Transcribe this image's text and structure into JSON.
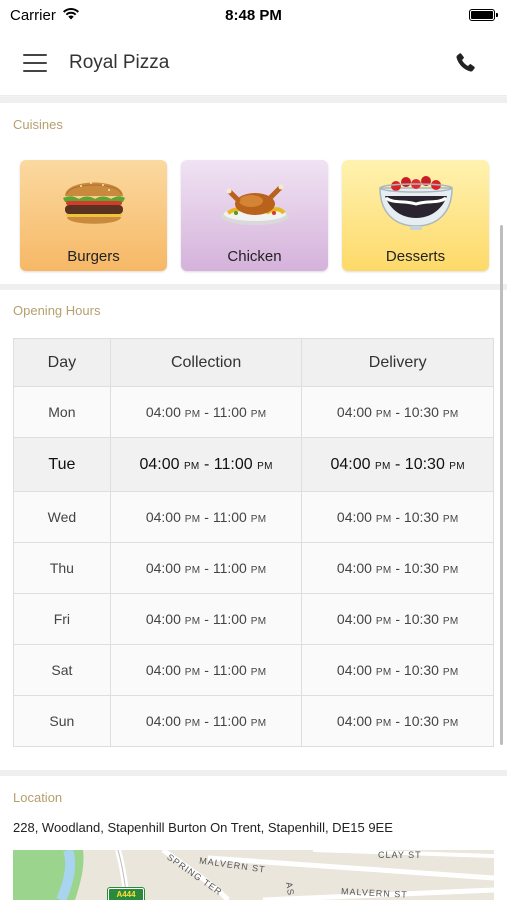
{
  "status_bar": {
    "carrier": "Carrier",
    "time": "8:48 PM"
  },
  "header": {
    "title": "Royal Pizza"
  },
  "cuisines": {
    "label": "Cuisines",
    "items": [
      {
        "name": "Burgers",
        "icon": "burger-icon"
      },
      {
        "name": "Chicken",
        "icon": "roast-chicken-icon"
      },
      {
        "name": "Desserts",
        "icon": "dessert-bowl-icon"
      }
    ]
  },
  "opening_hours": {
    "label": "Opening Hours",
    "columns": [
      "Day",
      "Collection",
      "Delivery"
    ],
    "rows": [
      {
        "day": "Mon",
        "collection": [
          "04:00",
          "PM",
          "11:00",
          "PM"
        ],
        "delivery": [
          "04:00",
          "PM",
          "10:30",
          "PM"
        ]
      },
      {
        "day": "Tue",
        "collection": [
          "04:00",
          "PM",
          "11:00",
          "PM"
        ],
        "delivery": [
          "04:00",
          "PM",
          "10:30",
          "PM"
        ],
        "highlight": true
      },
      {
        "day": "Wed",
        "collection": [
          "04:00",
          "PM",
          "11:00",
          "PM"
        ],
        "delivery": [
          "04:00",
          "PM",
          "10:30",
          "PM"
        ]
      },
      {
        "day": "Thu",
        "collection": [
          "04:00",
          "PM",
          "11:00",
          "PM"
        ],
        "delivery": [
          "04:00",
          "PM",
          "10:30",
          "PM"
        ]
      },
      {
        "day": "Fri",
        "collection": [
          "04:00",
          "PM",
          "11:00",
          "PM"
        ],
        "delivery": [
          "04:00",
          "PM",
          "10:30",
          "PM"
        ]
      },
      {
        "day": "Sat",
        "collection": [
          "04:00",
          "PM",
          "11:00",
          "PM"
        ],
        "delivery": [
          "04:00",
          "PM",
          "10:30",
          "PM"
        ]
      },
      {
        "day": "Sun",
        "collection": [
          "04:00",
          "PM",
          "11:00",
          "PM"
        ],
        "delivery": [
          "04:00",
          "PM",
          "10:30",
          "PM"
        ]
      }
    ]
  },
  "location": {
    "label": "Location",
    "address": "228, Woodland, Stapenhill Burton On Trent, Stapenhill, DE15 9EE",
    "map_labels": [
      "SPRING TER",
      "MALVERN ST",
      "CLAY ST",
      "MALVERN ST",
      "AS"
    ],
    "road_badge": "A444"
  },
  "colors": {
    "section_label": "#b5a06e",
    "burgers_bg": "#f6b866",
    "chicken_bg": "#d5b2db",
    "desserts_bg": "#fdd969"
  }
}
